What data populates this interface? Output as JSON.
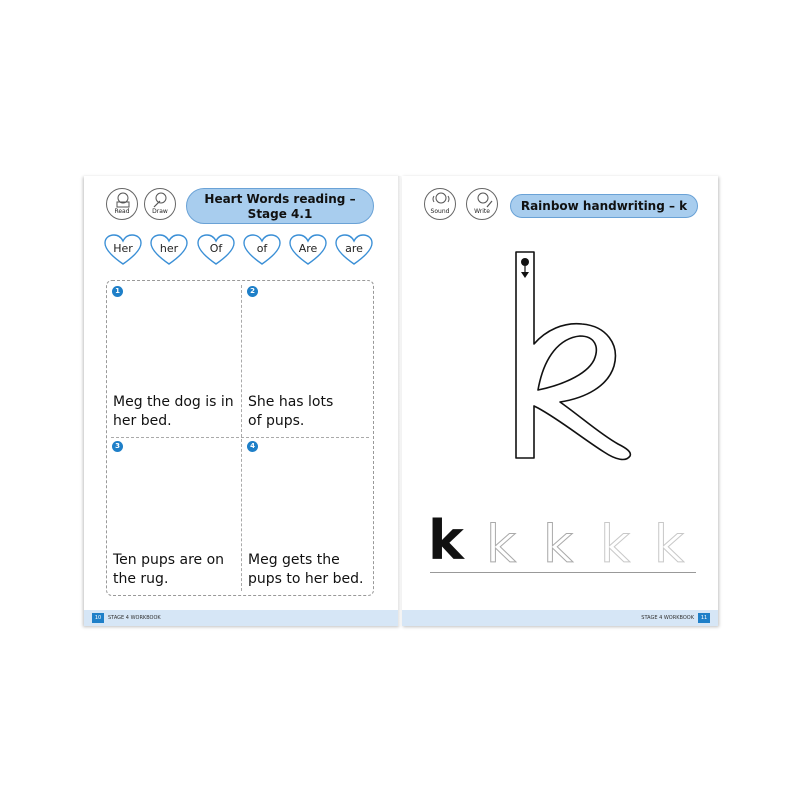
{
  "left_page": {
    "icons": [
      {
        "name": "read-icon",
        "label": "Read"
      },
      {
        "name": "draw-icon",
        "label": "Draw"
      }
    ],
    "title_line1": "Heart Words reading –",
    "title_line2": "Stage 4.1",
    "heart_words": [
      "Her",
      "her",
      "Of",
      "of",
      "Are",
      "are"
    ],
    "panels": [
      {
        "number": "1",
        "caption_line1": "Meg the dog is in",
        "caption_line2": "her bed."
      },
      {
        "number": "2",
        "caption_line1": "She has lots",
        "caption_line2": "of pups."
      },
      {
        "number": "3",
        "caption_line1": "Ten pups are on",
        "caption_line2": "the rug."
      },
      {
        "number": "4",
        "caption_line1": "Meg gets the",
        "caption_line2": "pups to her bed."
      }
    ],
    "footer": {
      "page_number": "10",
      "text": "STAGE 4 WORKBOOK"
    }
  },
  "right_page": {
    "icons": [
      {
        "name": "sound-icon",
        "label": "Sound"
      },
      {
        "name": "write-icon",
        "label": "Write"
      }
    ],
    "title": "Rainbow handwriting – k",
    "practice_letter": "k",
    "footer": {
      "page_number": "11",
      "text": "STAGE 4 WORKBOOK"
    }
  },
  "colors": {
    "accent_blue": "#1e7fc8",
    "pill_fill": "#a8cdee",
    "footer_band": "#d6e6f6",
    "heart_stroke": "#3a8fd6"
  }
}
